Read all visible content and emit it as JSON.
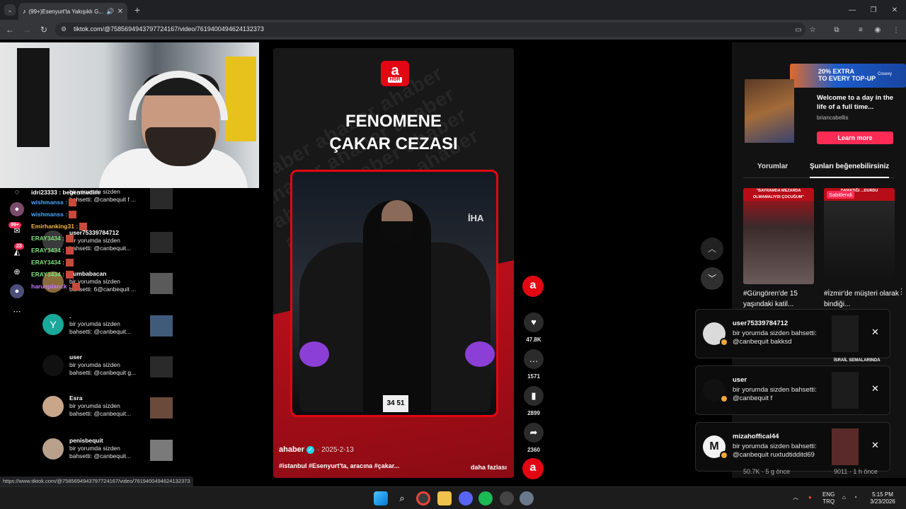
{
  "browser": {
    "tab_title": "(99+)Esenyurt'ta Yakışıklı G...",
    "url": "tiktok.com/@7585694943797724167/video/7619400494624132373",
    "status_url": "https://www.tiktok.com/@7585694943797724167/video/7619400494624132373"
  },
  "sidebar": {
    "badge_messages": "99+",
    "badge_activity": "23"
  },
  "chat": [
    {
      "user": "idri23333 :",
      "text": "begenmedim",
      "color": "#ffffff"
    },
    {
      "user": "wishmanss :",
      "text": "",
      "color": "#4aa8ff"
    },
    {
      "user": "wishmanss :",
      "text": "",
      "color": "#4aa8ff"
    },
    {
      "user": "Emirhanking31 :",
      "text": "",
      "color": "#f4b942"
    },
    {
      "user": "ERAY3434 :",
      "text": "",
      "color": "#7fe07f"
    },
    {
      "user": "ERAY3434 :",
      "text": "",
      "color": "#7fe07f"
    },
    {
      "user": "ERAY3434 :",
      "text": "",
      "color": "#7fe07f"
    },
    {
      "user": "ERAY3434 :",
      "text": "",
      "color": "#7fe07f"
    },
    {
      "user": "harunplanck :",
      "text": "",
      "color": "#c57cff"
    }
  ],
  "notifications": [
    {
      "user": "",
      "line1": "bir yorumda sizden",
      "line2": "bahsetti: @canbequit f ..."
    },
    {
      "user": "user75339784712",
      "line1": "bir yorumda sizden",
      "line2": "bahsetti: @canbequit..."
    },
    {
      "user": "qumbabacan",
      "line1": "bir yorumda sizden",
      "line2": "bahsetti: 6@canbequit ..."
    },
    {
      "user": ".",
      "line1": "bir yorumda sizden",
      "line2": "bahsetti: @canbequit...",
      "avatar": "Y"
    },
    {
      "user": "user",
      "line1": "bir yorumda sizden",
      "line2": "bahsetti: @canbequit g..."
    },
    {
      "user": "Esra",
      "line1": "bir yorumda sizden",
      "line2": "bahsetti: @canbequit..."
    },
    {
      "user": "penisbequit",
      "line1": "bir yorumda sizden",
      "line2": "bahsetti: @canbequit..."
    }
  ],
  "video": {
    "logo_letter": "a",
    "logo_sub": "HBR",
    "headline_1": "FENOMENE",
    "headline_2": "ÇAKAR CEZASI",
    "source_tag": "İHA",
    "plate": "34 51",
    "author": "ahaber",
    "date": "· 2025-2-13",
    "caption": "#istanbul #Esenyurt'ta, aracına #çakar...",
    "more_label": "daha fazlası"
  },
  "actions": {
    "likes": "47.8K",
    "comments": "1571",
    "saves": "2899",
    "shares": "2360"
  },
  "right_panel": {
    "ad_banner": "20% EXTRA",
    "ad_banner_2": "TO EVERY TOP-UP",
    "ad_brand": "Cosexy",
    "ad_title": "Welcome to a day in the life of a full time...",
    "ad_user": "briancabellis",
    "ad_button": "Learn more",
    "tab_comments": "Yorumlar",
    "tab_suggested": "Şunları beğenebilirsiniz",
    "related": [
      {
        "top": "\"BAYRAMDA MEZARDA OLMAMALIYDI ÇOCUĞUM\"",
        "caption": "#Güngören'de 15 yaşındaki katil..."
      },
      {
        "top": "DAMATIĞI ...DURDU",
        "caption": "#İzmir'de müşteri olarak bindiği...",
        "pinned": "Sabitlendi"
      }
    ],
    "hidden_label": "İSRAİL SEMALARINDA",
    "stat_left": "50.7K · 5 g önce",
    "stat_right": "9011 · 1 h önce"
  },
  "toasts": [
    {
      "user": "user75339784712",
      "msg": "bir yorumda sizden bahsetti: @canbequit bakksd",
      "avatar": ""
    },
    {
      "user": "user",
      "msg": "bir yorumda sizden bahsetti: @canbequit f",
      "avatar": ""
    },
    {
      "user": "mizahoffical44",
      "msg": "bir yorumda sizden bahsetti: @canbequit ruxtudtidditd69",
      "avatar": "M"
    }
  ],
  "taskbar": {
    "lang_1": "ENG",
    "lang_2": "TRQ",
    "time": "5:15 PM",
    "date": "3/23/2026"
  }
}
